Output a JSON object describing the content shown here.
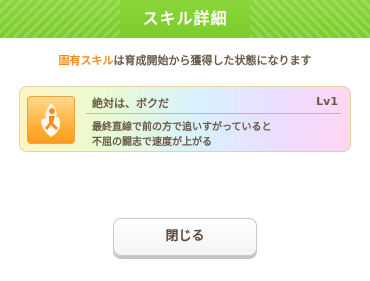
{
  "dialog": {
    "title": "スキル詳細",
    "notice_highlight": "固有スキル",
    "notice_rest": "は育成開始から獲得した状態になります"
  },
  "skill": {
    "name": "絶対は、ボクだ",
    "level": "Lv1",
    "description_line1": "最終直線で前の方で追いすがっていると",
    "description_line2": "不屈の闘志で速度が上がる",
    "icon": "running-figure-icon"
  },
  "actions": {
    "close_label": "閉じる"
  },
  "colors": {
    "header": "#7bcc2a",
    "highlight": "#f08a1c",
    "text": "#6a5a4a",
    "icon_bg": "#ffb23c"
  }
}
